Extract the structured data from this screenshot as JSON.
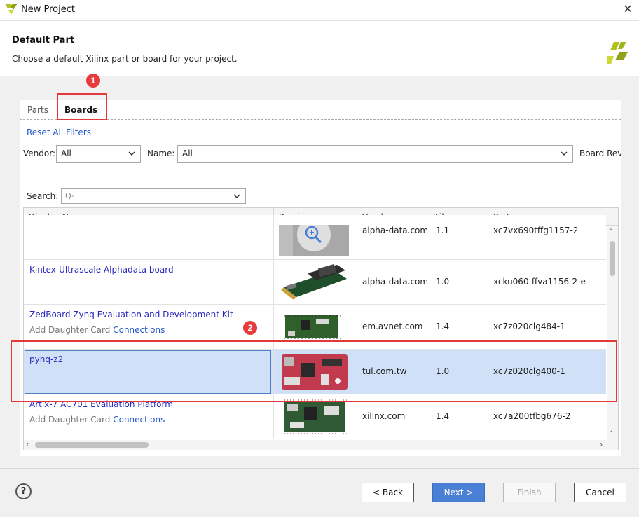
{
  "window": {
    "title": "New Project",
    "close_glyph": "✕"
  },
  "header": {
    "title": "Default Part",
    "subtitle": "Choose a default Xilinx part or board for your project."
  },
  "annotations": {
    "badge1": "1",
    "badge2": "2"
  },
  "tabs": [
    {
      "label": "Parts"
    },
    {
      "label": "Boards",
      "active": true
    }
  ],
  "filters": {
    "reset_label": "Reset All Filters",
    "vendor_label": "Vendor:",
    "vendor_value": "All",
    "name_label": "Name:",
    "name_value": "All",
    "board_rev_label": "Board Rev",
    "search_label": "Search:",
    "search_placeholder": "Q-"
  },
  "table": {
    "columns": [
      "Display Name",
      "Preview",
      "Vendor",
      "File Version",
      "Part"
    ],
    "rows": [
      {
        "name": "",
        "vendor": "alpha-data.com",
        "version": "1.1",
        "part": "xc7vx690tffg1157-2"
      },
      {
        "name": "Kintex-Ultrascale Alphadata board",
        "vendor": "alpha-data.com",
        "version": "1.0",
        "part": "xcku060-ffva1156-2-e"
      },
      {
        "name": "ZedBoard Zynq Evaluation and Development Kit",
        "sub_grey": "Add Daughter Card",
        "sub_link": "Connections",
        "vendor": "em.avnet.com",
        "version": "1.4",
        "part": "xc7z020clg484-1"
      },
      {
        "name": "pynq-z2",
        "vendor": "tul.com.tw",
        "version": "1.0",
        "part": "xc7z020clg400-1",
        "selected": true
      },
      {
        "name": "Artix-7 AC701 Evaluation Platform",
        "sub_grey": "Add Daughter Card",
        "sub_link": "Connections",
        "vendor": "xilinx.com",
        "version": "1.4",
        "part": "xc7a200tfbg676-2"
      }
    ]
  },
  "footer": {
    "help": "?",
    "back": "< Back",
    "next": "Next >",
    "finish": "Finish",
    "cancel": "Cancel"
  },
  "colors": {
    "accent": "#4a7fd6",
    "highlight": "#e03a3a",
    "selected_row": "#cfe0f7"
  }
}
